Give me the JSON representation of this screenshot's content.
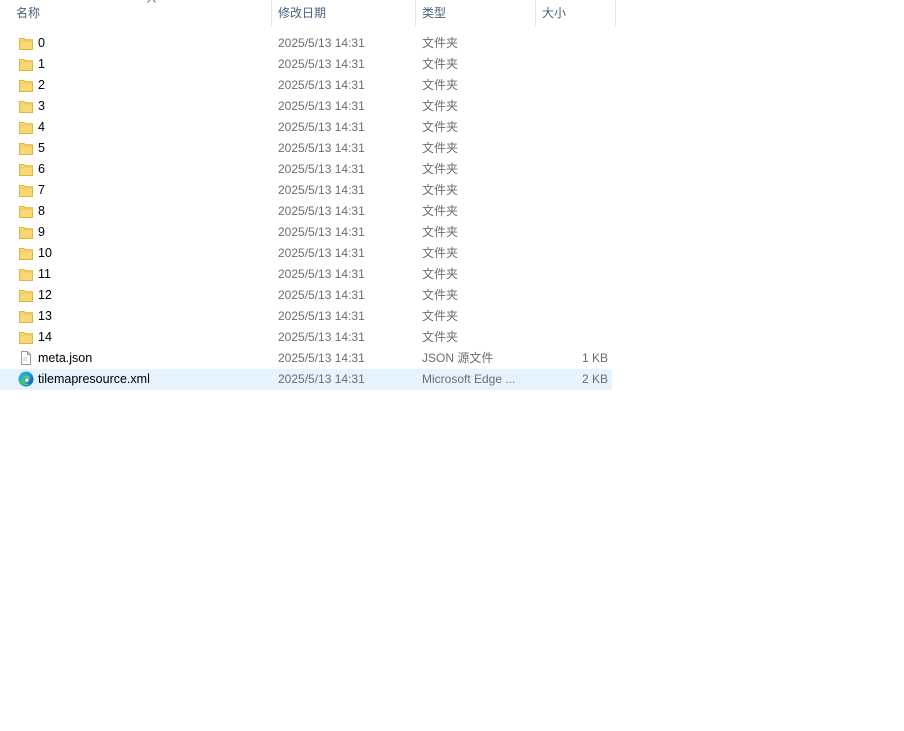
{
  "columns": {
    "name": "名称",
    "date": "修改日期",
    "type": "类型",
    "size": "大小"
  },
  "sort": {
    "column": "name",
    "direction": "ascending",
    "icon": "chevron-up-icon"
  },
  "colors": {
    "header_text": "#4c607a",
    "secondary_text": "#6d6d6d",
    "selection": "#e5f3ff",
    "folder": "#f8d775"
  },
  "files": [
    {
      "name": "0",
      "date": "2025/5/13 14:31",
      "type": "文件夹",
      "size": "",
      "icon": "folder-icon"
    },
    {
      "name": "1",
      "date": "2025/5/13 14:31",
      "type": "文件夹",
      "size": "",
      "icon": "folder-icon"
    },
    {
      "name": "2",
      "date": "2025/5/13 14:31",
      "type": "文件夹",
      "size": "",
      "icon": "folder-icon"
    },
    {
      "name": "3",
      "date": "2025/5/13 14:31",
      "type": "文件夹",
      "size": "",
      "icon": "folder-icon"
    },
    {
      "name": "4",
      "date": "2025/5/13 14:31",
      "type": "文件夹",
      "size": "",
      "icon": "folder-icon"
    },
    {
      "name": "5",
      "date": "2025/5/13 14:31",
      "type": "文件夹",
      "size": "",
      "icon": "folder-icon"
    },
    {
      "name": "6",
      "date": "2025/5/13 14:31",
      "type": "文件夹",
      "size": "",
      "icon": "folder-icon"
    },
    {
      "name": "7",
      "date": "2025/5/13 14:31",
      "type": "文件夹",
      "size": "",
      "icon": "folder-icon"
    },
    {
      "name": "8",
      "date": "2025/5/13 14:31",
      "type": "文件夹",
      "size": "",
      "icon": "folder-icon"
    },
    {
      "name": "9",
      "date": "2025/5/13 14:31",
      "type": "文件夹",
      "size": "",
      "icon": "folder-icon"
    },
    {
      "name": "10",
      "date": "2025/5/13 14:31",
      "type": "文件夹",
      "size": "",
      "icon": "folder-icon"
    },
    {
      "name": "11",
      "date": "2025/5/13 14:31",
      "type": "文件夹",
      "size": "",
      "icon": "folder-icon"
    },
    {
      "name": "12",
      "date": "2025/5/13 14:31",
      "type": "文件夹",
      "size": "",
      "icon": "folder-icon"
    },
    {
      "name": "13",
      "date": "2025/5/13 14:31",
      "type": "文件夹",
      "size": "",
      "icon": "folder-icon"
    },
    {
      "name": "14",
      "date": "2025/5/13 14:31",
      "type": "文件夹",
      "size": "",
      "icon": "folder-icon"
    },
    {
      "name": "meta.json",
      "date": "2025/5/13 14:31",
      "type": "JSON 源文件",
      "size": "1 KB",
      "icon": "json-file-icon"
    },
    {
      "name": "tilemapresource.xml",
      "date": "2025/5/13 14:31",
      "type": "Microsoft Edge ...",
      "size": "2 KB",
      "icon": "edge-file-icon",
      "selected": true
    }
  ]
}
